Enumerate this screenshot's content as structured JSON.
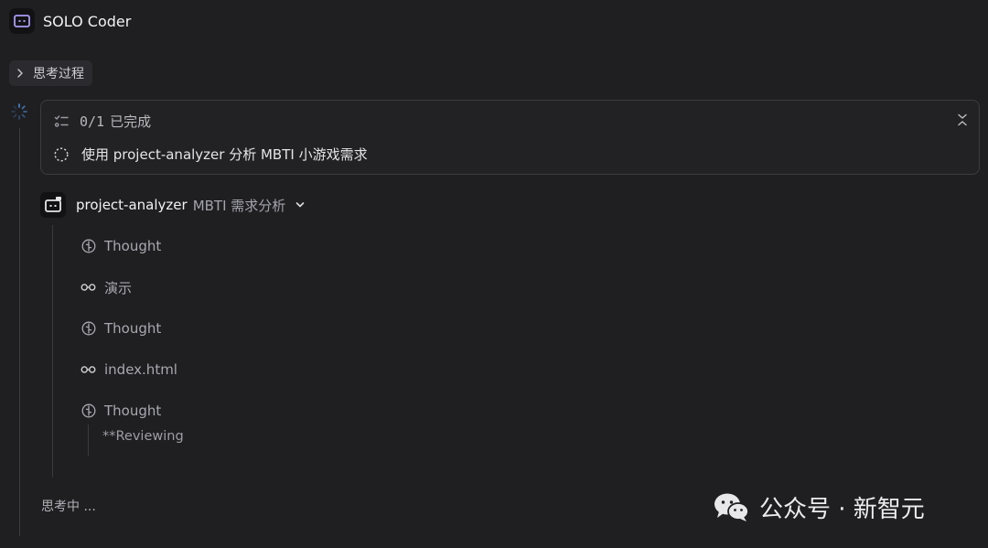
{
  "app": {
    "title": "SOLO Coder"
  },
  "thinking_toggle": {
    "label": "思考过程"
  },
  "tasks": {
    "count": "0/1",
    "status": "已完成",
    "items": [
      {
        "label": "使用 project-analyzer 分析 MBTI 小游戏需求"
      }
    ]
  },
  "agent": {
    "name": "project-analyzer",
    "task": "MBTI 需求分析",
    "steps": [
      {
        "label": "Thought",
        "icon": "brain-icon"
      },
      {
        "label": "演示",
        "icon": "glasses-icon"
      },
      {
        "label": "Thought",
        "icon": "brain-icon"
      },
      {
        "label": "index.html",
        "icon": "glasses-icon"
      },
      {
        "label": "Thought",
        "icon": "brain-icon"
      }
    ],
    "last_thought": "**Reviewing"
  },
  "status": {
    "thinking": "思考中 ..."
  },
  "watermark": {
    "text": "公众号 · 新智元"
  },
  "colors": {
    "accent": "#8b7cf6",
    "spinner": "#4a7dbf"
  }
}
